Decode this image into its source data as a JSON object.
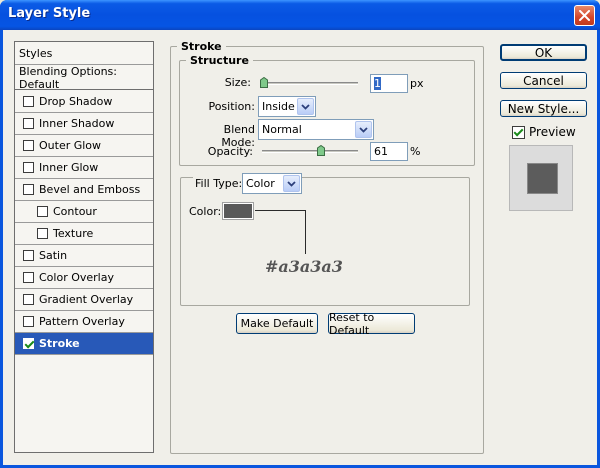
{
  "window": {
    "title": "Layer Style"
  },
  "styles_list": {
    "header": "Styles",
    "blending": "Blending Options: Default",
    "items": [
      {
        "label": "Drop Shadow",
        "checked": false,
        "indent": false
      },
      {
        "label": "Inner Shadow",
        "checked": false,
        "indent": false
      },
      {
        "label": "Outer Glow",
        "checked": false,
        "indent": false
      },
      {
        "label": "Inner Glow",
        "checked": false,
        "indent": false
      },
      {
        "label": "Bevel and Emboss",
        "checked": false,
        "indent": false
      },
      {
        "label": "Contour",
        "checked": false,
        "indent": true
      },
      {
        "label": "Texture",
        "checked": false,
        "indent": true
      },
      {
        "label": "Satin",
        "checked": false,
        "indent": false
      },
      {
        "label": "Color Overlay",
        "checked": false,
        "indent": false
      },
      {
        "label": "Gradient Overlay",
        "checked": false,
        "indent": false
      },
      {
        "label": "Pattern Overlay",
        "checked": false,
        "indent": false
      },
      {
        "label": "Stroke",
        "checked": true,
        "indent": false,
        "selected": true
      }
    ]
  },
  "stroke": {
    "title": "Stroke",
    "structure": {
      "title": "Structure",
      "size_label": "Size:",
      "size_value": "1",
      "size_unit": "px",
      "size_fraction": 0.0,
      "position_label": "Position:",
      "position_value": "Inside",
      "blend_label": "Blend Mode:",
      "blend_value": "Normal",
      "opacity_label": "Opacity:",
      "opacity_value": "61",
      "opacity_unit": "%",
      "opacity_fraction": 0.61
    },
    "fill": {
      "type_label": "Fill Type:",
      "type_value": "Color",
      "color_label": "Color:",
      "color_hex": "#595959",
      "annotation": "#a3a3a3"
    },
    "make_default": "Make Default",
    "reset_default": "Reset to Default"
  },
  "actions": {
    "ok": "OK",
    "cancel": "Cancel",
    "new_style": "New Style...",
    "preview_label": "Preview",
    "preview_checked": true
  },
  "colors": {
    "title_bar": "#0655e4",
    "selection": "#2859b8",
    "preview_fill": "#5c5c5c"
  }
}
